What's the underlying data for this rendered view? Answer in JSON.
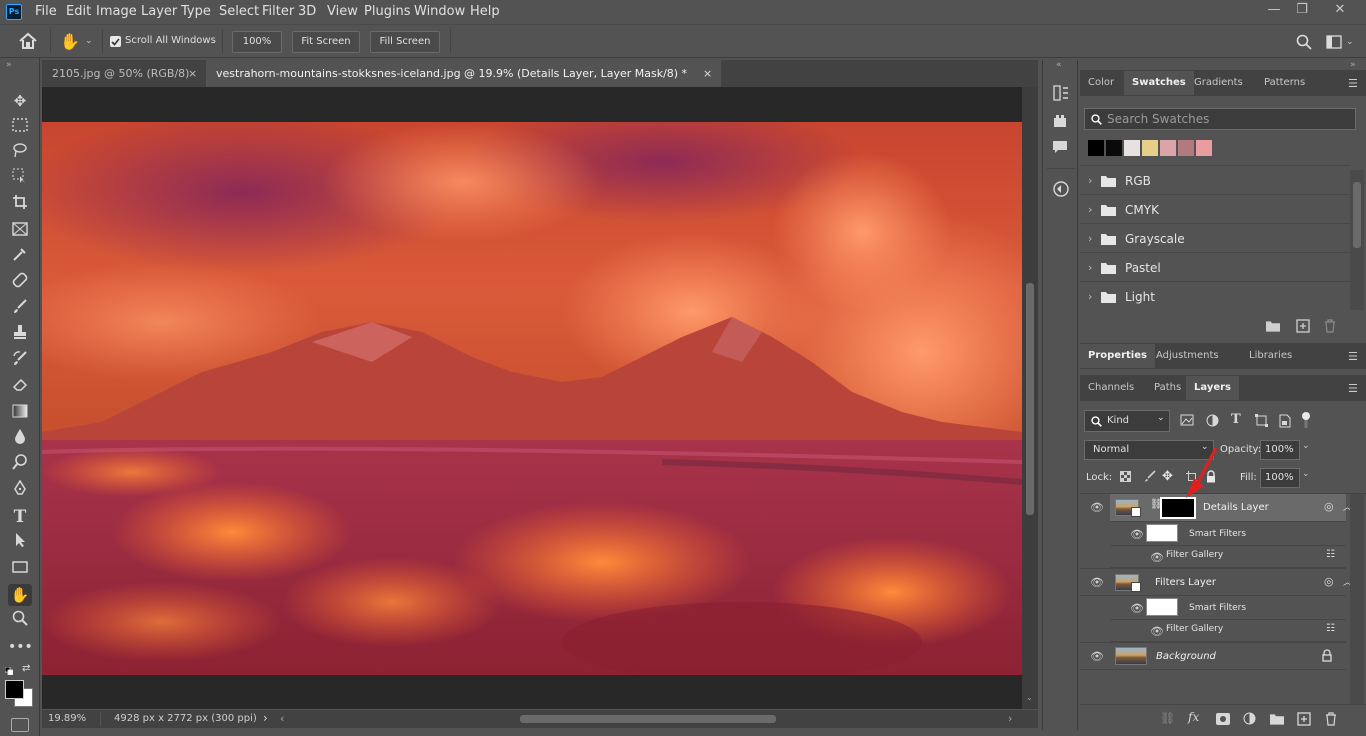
{
  "menu": {
    "logo": "Ps",
    "items": [
      "File",
      "Edit",
      "Image",
      "Layer",
      "Type",
      "Select",
      "Filter",
      "3D",
      "View",
      "Plugins",
      "Window",
      "Help"
    ]
  },
  "window_controls": {
    "minimize": "—",
    "restore": "❐",
    "close": "✕"
  },
  "options_bar": {
    "scroll_all_label": "Scroll All Windows",
    "scroll_all_checked": true,
    "zoom_button": "100%",
    "fit_screen": "Fit Screen",
    "fill_screen": "Fill Screen"
  },
  "doc_tabs": [
    {
      "label": "2105.jpg @ 50% (RGB/8)",
      "close": "×",
      "active": false
    },
    {
      "label": "vestrahorn-mountains-stokksnes-iceland.jpg @ 19.9% (Details Layer, Layer Mask/8) *",
      "close": "×",
      "active": true
    }
  ],
  "status": {
    "zoom": "19.89%",
    "doc_info": "4928 px x 2772 px (300 ppi)",
    "arrow": "›"
  },
  "swatches_panel": {
    "tabs": [
      "Color",
      "Swatches",
      "Gradients",
      "Patterns"
    ],
    "active_tab": "Swatches",
    "search_placeholder": "Search Swatches",
    "recent_colors": [
      "#000000",
      "#0a0a0a",
      "#e8e1e1",
      "#e6d089",
      "#dca4a8",
      "#b07a7f",
      "#ea9ca0"
    ],
    "folders": [
      "RGB",
      "CMYK",
      "Grayscale",
      "Pastel",
      "Light"
    ]
  },
  "properties_panel": {
    "tabs": [
      "Properties",
      "Adjustments",
      "Libraries"
    ],
    "active_tab": "Properties"
  },
  "layers_panel": {
    "tabs": [
      "Channels",
      "Paths",
      "Layers"
    ],
    "active_tab": "Layers",
    "filter_kind": "Kind",
    "blend_mode": "Normal",
    "opacity_label": "Opacity:",
    "opacity_value": "100%",
    "lock_label": "Lock:",
    "fill_label": "Fill:",
    "fill_value": "100%",
    "layers": [
      {
        "name": "Details Layer",
        "selected": true,
        "smart_filters": "Smart Filters",
        "filter": "Filter Gallery"
      },
      {
        "name": "Filters Layer",
        "selected": false,
        "smart_filters": "Smart Filters",
        "filter": "Filter Gallery"
      },
      {
        "name": "Background",
        "selected": false,
        "locked": true
      }
    ]
  },
  "colors": {
    "accent": "#e02020",
    "selected_layer": "#6a6a6a",
    "panel_bg": "#535353"
  }
}
